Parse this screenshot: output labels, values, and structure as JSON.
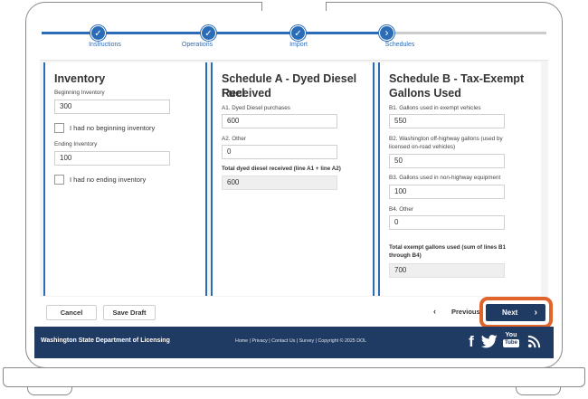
{
  "stepper": {
    "steps": [
      {
        "label": "Instructions",
        "icon": "check-icon",
        "glyph": "✓"
      },
      {
        "label": "Operations",
        "icon": "check-icon",
        "glyph": "✓"
      },
      {
        "label": "Import",
        "icon": "check-icon",
        "glyph": "✓"
      },
      {
        "label": "Schedules",
        "icon": "chevron-right-icon",
        "glyph": "›"
      }
    ],
    "active_color": "#2b6cb8",
    "inactive_color": "#cccccc"
  },
  "inventory": {
    "title": "Inventory",
    "beginning_label": "Beginning Inventory",
    "beginning_value": "300",
    "no_beginning_label": "I had no beginning inventory",
    "ending_label": "Ending Inventory",
    "ending_value": "100",
    "no_ending_label": "I had no ending inventory"
  },
  "schedule_a": {
    "title_line1": "Schedule A - Dyed Diesel Fuel",
    "title_line2": "Received",
    "a1_label": "A1. Dyed Diesel purchases",
    "a1_value": "600",
    "a2_label": "A2. Other",
    "a2_value": "0",
    "total_label": "Total dyed diesel received (line A1 + line A2)",
    "total_value": "600"
  },
  "schedule_b": {
    "title_line1": "Schedule B - Tax-Exempt",
    "title_line2": "Gallons Used",
    "b1_label": "B1. Gallons used in exempt vehicles",
    "b1_value": "550",
    "b2_label_line1": "B2. Washington off-highway gallons (used by",
    "b2_label_line2": "licensed on-road vehicles)",
    "b2_value": "50",
    "b3_label": "B3. Gallons used in non-highway equipment",
    "b3_value": "100",
    "b4_label": "B4. Other",
    "b4_value": "0",
    "total_label_line1": "Total exempt gallons used (sum of lines B1",
    "total_label_line2": "through B4)",
    "total_value": "700"
  },
  "actions": {
    "cancel_label": "Cancel",
    "save_draft_label": "Save Draft",
    "previous_label": "Previous",
    "previous_glyph": "‹",
    "next_label": "Next",
    "next_glyph": "›",
    "highlight_color": "#e0642b"
  },
  "footer": {
    "org_name": "Washington State Department of Licensing",
    "links": "Home | Privacy | Contact Us | Survey | Copyright © 2025 DOL",
    "social": [
      {
        "icon": "facebook-icon",
        "glyph": "f"
      },
      {
        "icon": "twitter-icon",
        "glyph": "🐦"
      },
      {
        "icon": "youtube-icon",
        "glyph_top": "You",
        "glyph_bottom": "Tube"
      },
      {
        "icon": "rss-icon",
        "glyph": "RSS"
      }
    ],
    "background": "#1f3a63"
  }
}
